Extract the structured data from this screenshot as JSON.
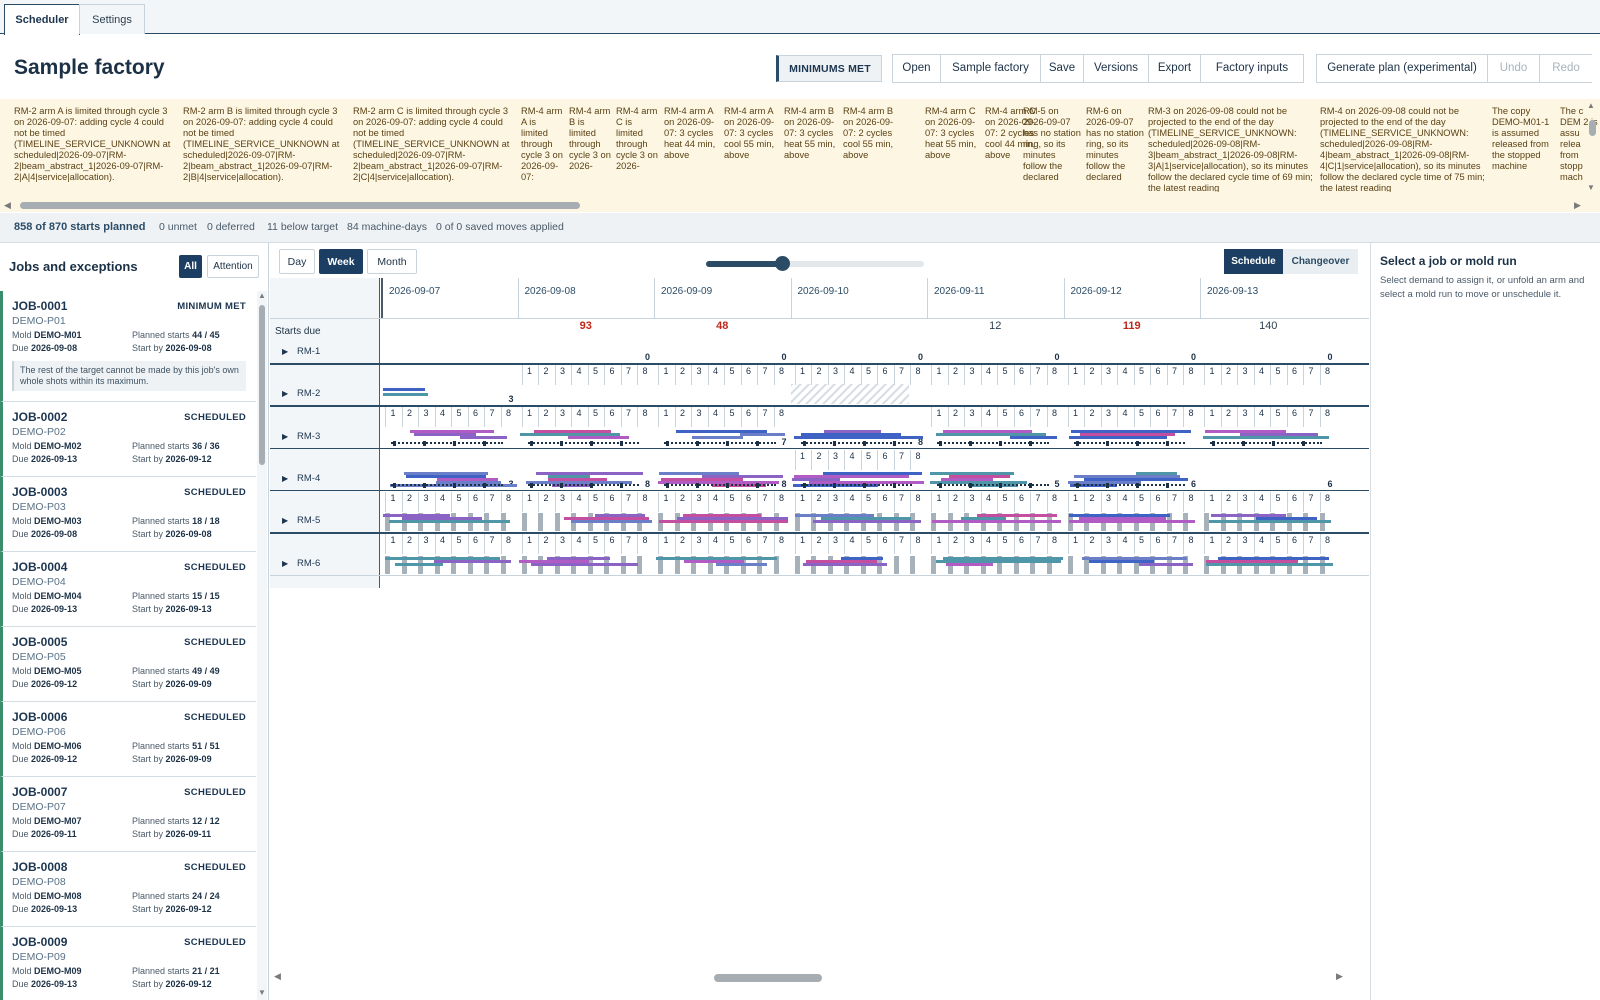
{
  "tabs": [
    {
      "label": "Scheduler",
      "active": true
    },
    {
      "label": "Settings",
      "active": false
    }
  ],
  "header": {
    "title": "Sample factory",
    "status": "MINIMUMS MET",
    "file_buttons": [
      "Open",
      "Sample factory",
      "Save",
      "Versions",
      "Export",
      "Factory inputs"
    ],
    "plan_buttons": [
      {
        "label": "Generate plan (experimental)",
        "enabled": true
      },
      {
        "label": "Undo",
        "enabled": false
      },
      {
        "label": "Redo",
        "enabled": false
      }
    ]
  },
  "warnings": [
    "RM-2 arm A is limited through cycle 3 on 2026-09-07: adding cycle 4 could not be timed (TIMELINE_SERVICE_UNKNOWN at scheduled|2026-09-07|RM-2|beam_abstract_1|2026-09-07|RM-2|A|4|service|allocation).",
    "RM-2 arm B is limited through cycle 3 on 2026-09-07: adding cycle 4 could not be timed (TIMELINE_SERVICE_UNKNOWN at scheduled|2026-09-07|RM-2|beam_abstract_1|2026-09-07|RM-2|B|4|service|allocation).",
    "RM-2 arm C is limited through cycle 3 on 2026-09-07: adding cycle 4 could not be timed (TIMELINE_SERVICE_UNKNOWN at scheduled|2026-09-07|RM-2|beam_abstract_1|2026-09-07|RM-2|C|4|service|allocation).",
    "RM-4 arm A is limited through cycle 3 on 2026-09-07:",
    "RM-4 arm B is limited through cycle 3 on 2026-",
    "RM-4 arm C is limited through cycle 3 on 2026-",
    "RM-4 arm A on 2026-09-07: 3 cycles heat 44 min, above",
    "RM-4 arm A on 2026-09-07: 3 cycles cool 55 min, above",
    "RM-4 arm B on 2026-09-07: 3 cycles heat 55 min, above",
    "RM-4 arm B on 2026-09-07: 2 cycles cool 55 min, above",
    "RM-4 arm C on 2026-09-07: 3 cycles heat 55 min, above",
    "RM-4 arm C on 2026-09-07: 2 cycles cool 44 min, above",
    "RM-5 on 2026-09-07 has no station ring, so its minutes follow the declared",
    "RM-6 on 2026-09-07 has no station ring, so its minutes follow the declared",
    "RM-3 on 2026-09-08 could not be projected to the end of the day (TIMELINE_SERVICE_UNKNOWN: scheduled|2026-09-08|RM-3|beam_abstract_1|2026-09-08|RM-3|A|1|service|allocation), so its minutes follow the declared cycle time of 69 min; the latest reading",
    "RM-4 on 2026-09-08 could not be projected to the end of the day (TIMELINE_SERVICE_UNKNOWN: scheduled|2026-09-08|RM-4|beam_abstract_1|2026-09-08|RM-4|C|1|service|allocation), so its minutes follow the declared cycle time of 75 min; the latest reading",
    "The copy DEMO-M01-1 is assumed released from the stopped machine",
    "The c DEM 2 is assu relea from stopp mach"
  ],
  "stats": {
    "planned": "858 of 870 starts planned",
    "unmet": "0 unmet",
    "deferred": "0 deferred",
    "below": "11 below target",
    "machine_days": "84 machine-days",
    "moves": "0 of 0 saved moves applied"
  },
  "left": {
    "title": "Jobs and exceptions",
    "filters": [
      {
        "label": "All",
        "active": true
      },
      {
        "label": "Attention",
        "active": false
      }
    ],
    "labels": {
      "mold": "Mold",
      "due": "Due",
      "planned": "Planned starts",
      "start_by": "Start by"
    },
    "jobs": [
      {
        "id": "JOB-0001",
        "status": "MINIMUM MET",
        "part": "DEMO-P01",
        "mold": "DEMO-M01",
        "due": "2026-09-08",
        "planned": "44 / 45",
        "start_by": "2026-09-08",
        "note": "The rest of the target cannot be made by this job's own whole shots within its maximum."
      },
      {
        "id": "JOB-0002",
        "status": "SCHEDULED",
        "part": "DEMO-P02",
        "mold": "DEMO-M02",
        "due": "2026-09-13",
        "planned": "36 / 36",
        "start_by": "2026-09-12"
      },
      {
        "id": "JOB-0003",
        "status": "SCHEDULED",
        "part": "DEMO-P03",
        "mold": "DEMO-M03",
        "due": "2026-09-08",
        "planned": "18 / 18",
        "start_by": "2026-09-08"
      },
      {
        "id": "JOB-0004",
        "status": "SCHEDULED",
        "part": "DEMO-P04",
        "mold": "DEMO-M04",
        "due": "2026-09-13",
        "planned": "15 / 15",
        "start_by": "2026-09-13"
      },
      {
        "id": "JOB-0005",
        "status": "SCHEDULED",
        "part": "DEMO-P05",
        "mold": "DEMO-M05",
        "due": "2026-09-12",
        "planned": "49 / 49",
        "start_by": "2026-09-09"
      },
      {
        "id": "JOB-0006",
        "status": "SCHEDULED",
        "part": "DEMO-P06",
        "mold": "DEMO-M06",
        "due": "2026-09-12",
        "planned": "51 / 51",
        "start_by": "2026-09-09"
      },
      {
        "id": "JOB-0007",
        "status": "SCHEDULED",
        "part": "DEMO-P07",
        "mold": "DEMO-M07",
        "due": "2026-09-11",
        "planned": "12 / 12",
        "start_by": "2026-09-11"
      },
      {
        "id": "JOB-0008",
        "status": "SCHEDULED",
        "part": "DEMO-P08",
        "mold": "DEMO-M08",
        "due": "2026-09-13",
        "planned": "24 / 24",
        "start_by": "2026-09-12"
      },
      {
        "id": "JOB-0009",
        "status": "SCHEDULED",
        "part": "DEMO-P09",
        "mold": "DEMO-M09",
        "due": "2026-09-13",
        "planned": "21 / 21",
        "start_by": "2026-09-12"
      }
    ]
  },
  "timeline": {
    "views": [
      {
        "label": "Day",
        "active": false
      },
      {
        "label": "Week",
        "active": true
      },
      {
        "label": "Month",
        "active": false
      }
    ],
    "zoom": 0.35,
    "modes": [
      {
        "label": "Schedule",
        "active": true
      },
      {
        "label": "Changeover",
        "active": false
      }
    ],
    "days": [
      "2026-09-07",
      "2026-09-08",
      "2026-09-09",
      "2026-09-10",
      "2026-09-11",
      "2026-09-12",
      "2026-09-13"
    ],
    "starts_due_label": "Starts due",
    "starts_due": [
      {
        "value": "",
        "alert": false
      },
      {
        "value": "93",
        "alert": true
      },
      {
        "value": "48",
        "alert": true
      },
      {
        "value": "",
        "alert": false
      },
      {
        "value": "12",
        "alert": false
      },
      {
        "value": "119",
        "alert": true
      },
      {
        "value": "140",
        "alert": false
      }
    ],
    "cycle_labels": [
      "1",
      "2",
      "3",
      "4",
      "5",
      "6",
      "7",
      "8"
    ],
    "arms": [
      {
        "name": "RM-1",
        "counts": [
          "",
          "0",
          "0",
          "0",
          "0",
          "0",
          "0"
        ]
      },
      {
        "name": "RM-2",
        "counts": [
          "3",
          "",
          "",
          "",
          "",
          "",
          ""
        ]
      },
      {
        "name": "RM-3",
        "counts": [
          "",
          "",
          "7",
          "8",
          "",
          "",
          ""
        ]
      },
      {
        "name": "RM-4",
        "counts": [
          "3",
          "8",
          "8",
          "",
          "5",
          "6",
          "6"
        ]
      },
      {
        "name": "RM-5",
        "counts": [
          "",
          "",
          "",
          "",
          "",
          "",
          ""
        ]
      },
      {
        "name": "RM-6",
        "counts": [
          "",
          "",
          "",
          "",
          "",
          "",
          ""
        ]
      }
    ]
  },
  "right": {
    "title": "Select a job or mold run",
    "description": "Select demand to assign it, or unfold an arm and select a mold run to move or unschedule it."
  },
  "colors": {
    "accent": "#1c3e63",
    "alert": "#c0281a",
    "warning_bg": "#fdf6e3",
    "job_ok": "#3a8d6b",
    "purple": "#b05cc4",
    "blue": "#3e63c4",
    "teal": "#4f97a8"
  }
}
